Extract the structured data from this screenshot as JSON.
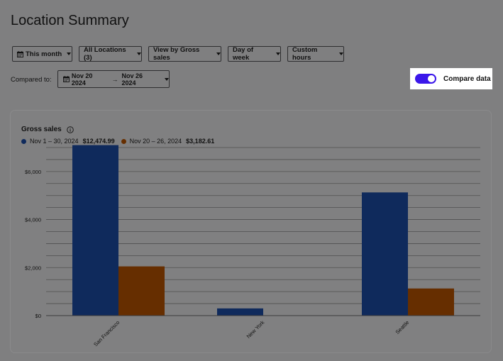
{
  "page": {
    "title": "Location Summary"
  },
  "filters": [
    {
      "label": "This month",
      "icon": "calendar-icon"
    },
    {
      "label": "All Locations (3)"
    },
    {
      "label": "View by Gross sales"
    },
    {
      "label": "Day of week"
    },
    {
      "label": "Custom hours"
    }
  ],
  "comparison": {
    "label": "Compared to:",
    "start": "Nov 20 2024",
    "arrow": "→",
    "end": "Nov 26 2024",
    "toggle_label": "Compare data",
    "toggle_on": true,
    "toggle_color": "#3b17ea"
  },
  "chart": {
    "title": "Gross sales",
    "legend": [
      {
        "range": "Nov 1 – 30, 2024",
        "total": "$12,474.99",
        "color": "#0f2a5c"
      },
      {
        "range": "Nov 20 – 26, 2024",
        "total": "$3,182.61",
        "color": "#662e00"
      }
    ]
  },
  "chart_data": {
    "type": "bar",
    "categories": [
      "San Francisco",
      "New York",
      "Seattle"
    ],
    "series": [
      {
        "name": "Nov 1 – 30, 2024",
        "values": [
          7100,
          300,
          5130
        ]
      },
      {
        "name": "Nov 20 – 26, 2024",
        "values": [
          2050,
          0,
          1130
        ]
      }
    ],
    "ylim": [
      0,
      7000
    ],
    "yticks": [
      0,
      2000,
      4000,
      6000
    ],
    "ytick_labels": [
      "$0",
      "$2,000",
      "$4,000",
      "$6,000"
    ],
    "grid": true,
    "colors": [
      "#0f2a5c",
      "#662e00"
    ]
  }
}
